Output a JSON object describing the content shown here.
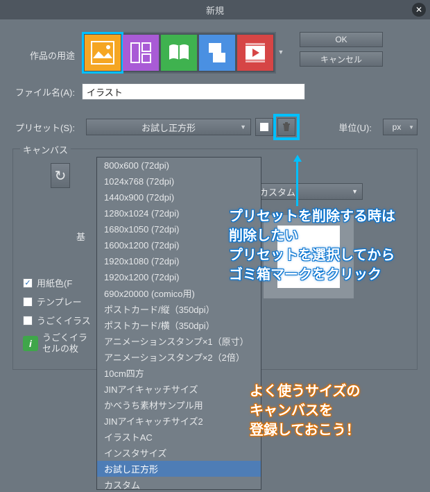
{
  "title": "新規",
  "labels": {
    "purpose": "作品の用途",
    "filename": "ファイル名(A):",
    "preset": "プリセット(S):",
    "unit": "単位(U):",
    "canvas_group": "キャンバス",
    "base": "基",
    "paper_color": "用紙色(F",
    "template": "テンプレー",
    "ugoku": "うごくイラス",
    "ugoku_cell1": "うごくイラ",
    "ugoku_cell2": "セルの枚"
  },
  "buttons": {
    "ok": "OK",
    "cancel": "キャンセル"
  },
  "filename_value": "イラスト",
  "preset_value": "お試し正方形",
  "unit_value": "px",
  "custom_value": "カスタム",
  "preset_options": [
    "800x600 (72dpi)",
    "1024x768 (72dpi)",
    "1440x900 (72dpi)",
    "1280x1024 (72dpi)",
    "1680x1050 (72dpi)",
    "1600x1200 (72dpi)",
    "1920x1080 (72dpi)",
    "1920x1200 (72dpi)",
    "690x20000 (comico用)",
    "ポストカード/縦（350dpi）",
    "ポストカード/横（350dpi）",
    "アニメーションスタンプ×1（原寸）",
    "アニメーションスタンプ×2（2倍）",
    "10cm四方",
    "JINアイキャッチサイズ",
    "かべうち素材サンプル用",
    "JINアイキャッチサイズ2",
    "イラストAC",
    "インスタサイズ",
    "お試し正方形",
    "カスタム"
  ],
  "selected_option_index": 19,
  "purpose_icons": [
    {
      "name": "illustration-icon",
      "color": "#f5a623"
    },
    {
      "name": "comic-icon",
      "color": "#a95bd6"
    },
    {
      "name": "book-icon",
      "color": "#3fb24f"
    },
    {
      "name": "print-icon",
      "color": "#4a90e2"
    },
    {
      "name": "animation-icon",
      "color": "#d64545"
    }
  ],
  "annotations": {
    "delete_note": "プリセットを削除する時は\n削除したい\nプリセットを選択してから\nゴミ箱マークをクリック",
    "register_note": "よく使うサイズの\nキャンバスを\n登録しておこう！"
  }
}
